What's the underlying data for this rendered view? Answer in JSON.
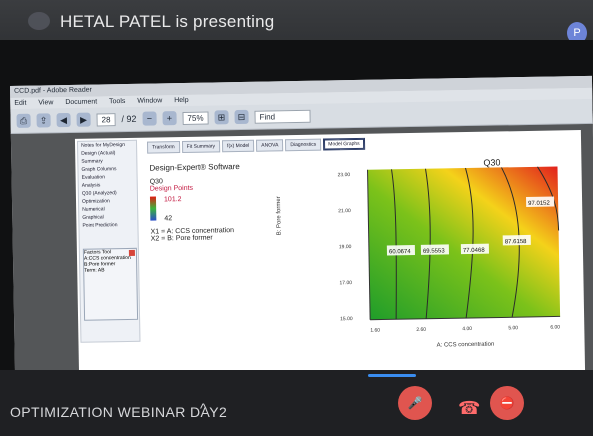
{
  "banner": {
    "text": "HETAL PATEL is presenting",
    "avatar": "P"
  },
  "app": {
    "title": "CCD.pdf - Adobe Reader",
    "menu": [
      "Edit",
      "View",
      "Document",
      "Tools",
      "Window",
      "Help"
    ],
    "toolbar": {
      "page_value": "28",
      "page_total": "/ 92",
      "zoom": "75%",
      "find_placeholder": "Find"
    }
  },
  "design_expert": {
    "tabs": [
      "Transform",
      "Fit Summary",
      "f(x) Model",
      "ANOVA",
      "Diagnostics",
      "Model Graphs"
    ],
    "active_tab": "Model Graphs",
    "tree": [
      "Notes for MyDesign",
      "Design (Actual)",
      "Summary",
      "Graph Columns",
      "Evaluation",
      "Analysis",
      "Q30 (Analyzed)",
      "Optimization",
      "Numerical",
      "Graphical",
      "Point Prediction"
    ],
    "factors_tool": {
      "title": "Factors Tool",
      "items": [
        "A:CCS concentration",
        "B:Pore former"
      ],
      "term": "Term: AB"
    },
    "software": "Design-Expert® Software",
    "response_name": "Q30",
    "design_points": "Design Points",
    "high": "101.2",
    "low": "42",
    "x1": "X1 = A: CCS concentration",
    "x2": "X2 = B: Pore former"
  },
  "chart_data": {
    "type": "heatmap",
    "title": "Q30",
    "xlabel": "A: CCS concentration",
    "ylabel": "B: Pore former",
    "x_ticks": [
      "1.60",
      "2.60",
      "4.00",
      "5.00",
      "6.00"
    ],
    "y_ticks": [
      "15.00",
      "17.00",
      "19.00",
      "21.00",
      "23.00"
    ],
    "contour_labels": [
      "60.0674",
      "69.5553",
      "77.0468",
      "87.6158",
      "97.0152"
    ],
    "colors": {
      "low": "#1f9d2a",
      "mid": "#f4d21a",
      "high": "#e2201c"
    }
  },
  "call": {
    "meeting_name": "OPTIMIZATION WEBINAR DAY2"
  }
}
